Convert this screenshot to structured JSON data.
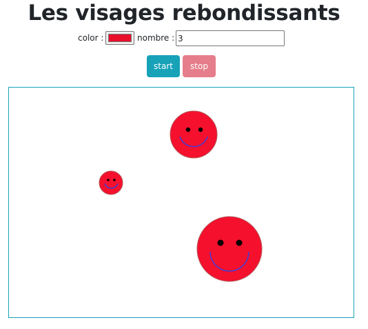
{
  "page": {
    "title": "Les visages rebondissants"
  },
  "controls": {
    "color_label": "color :",
    "color_value": "#e8102b",
    "count_label": "nombre :",
    "count_value": "3"
  },
  "buttons": {
    "start_label": "start",
    "stop_label": "stop",
    "start_color": "#17a2b8",
    "stop_color": "#e57e8a"
  },
  "faces": {
    "fill": "#f5102d",
    "outline": "#b05a5a",
    "eye_color": "#000000",
    "smile_color": "#3d3dd9",
    "count_displayed": 3
  }
}
